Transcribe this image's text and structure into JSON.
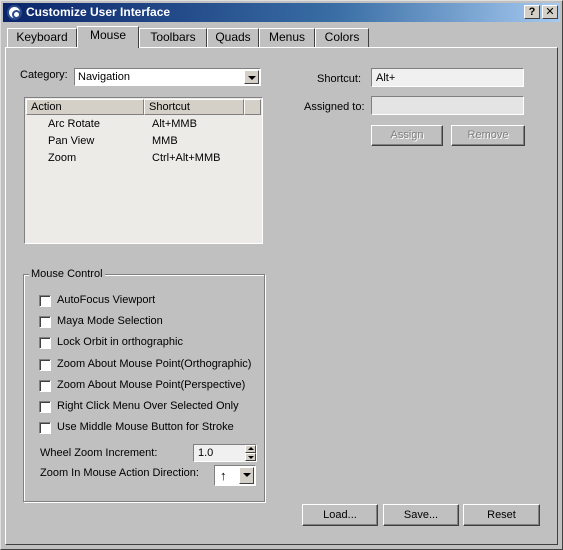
{
  "window": {
    "title": "Customize User Interface",
    "help_button": "?",
    "close_button": "✕"
  },
  "tabs": [
    {
      "label": "Keyboard"
    },
    {
      "label": "Mouse"
    },
    {
      "label": "Toolbars"
    },
    {
      "label": "Quads"
    },
    {
      "label": "Menus"
    },
    {
      "label": "Colors"
    }
  ],
  "active_tab": "Mouse",
  "category": {
    "label": "Category:",
    "value": "Navigation"
  },
  "action_list": {
    "columns": [
      "Action",
      "Shortcut"
    ],
    "rows": [
      {
        "action": "Arc Rotate",
        "shortcut": "Alt+MMB"
      },
      {
        "action": "Pan View",
        "shortcut": "MMB"
      },
      {
        "action": "Zoom",
        "shortcut": "Ctrl+Alt+MMB"
      }
    ]
  },
  "shortcut": {
    "label": "Shortcut:",
    "value": "Alt+"
  },
  "assigned_to": {
    "label": "Assigned to:",
    "value": ""
  },
  "buttons": {
    "assign": "Assign",
    "remove": "Remove",
    "load": "Load...",
    "save": "Save...",
    "reset": "Reset"
  },
  "mouse_control": {
    "title": "Mouse Control",
    "options": [
      {
        "label": "AutoFocus Viewport",
        "checked": false
      },
      {
        "label": "Maya Mode Selection",
        "checked": false
      },
      {
        "label": "Lock Orbit in orthographic",
        "checked": false
      },
      {
        "label": "Zoom About Mouse Point(Orthographic)",
        "checked": false
      },
      {
        "label": "Zoom About Mouse Point(Perspective)",
        "checked": false
      },
      {
        "label": "Right Click Menu Over Selected Only",
        "checked": false
      },
      {
        "label": "Use Middle Mouse Button for Stroke",
        "checked": false
      }
    ],
    "wheel_zoom": {
      "label": "Wheel Zoom Increment:",
      "value": "1.0"
    },
    "zoom_direction": {
      "label": "Zoom In Mouse Action Direction:",
      "value": "↑"
    }
  }
}
